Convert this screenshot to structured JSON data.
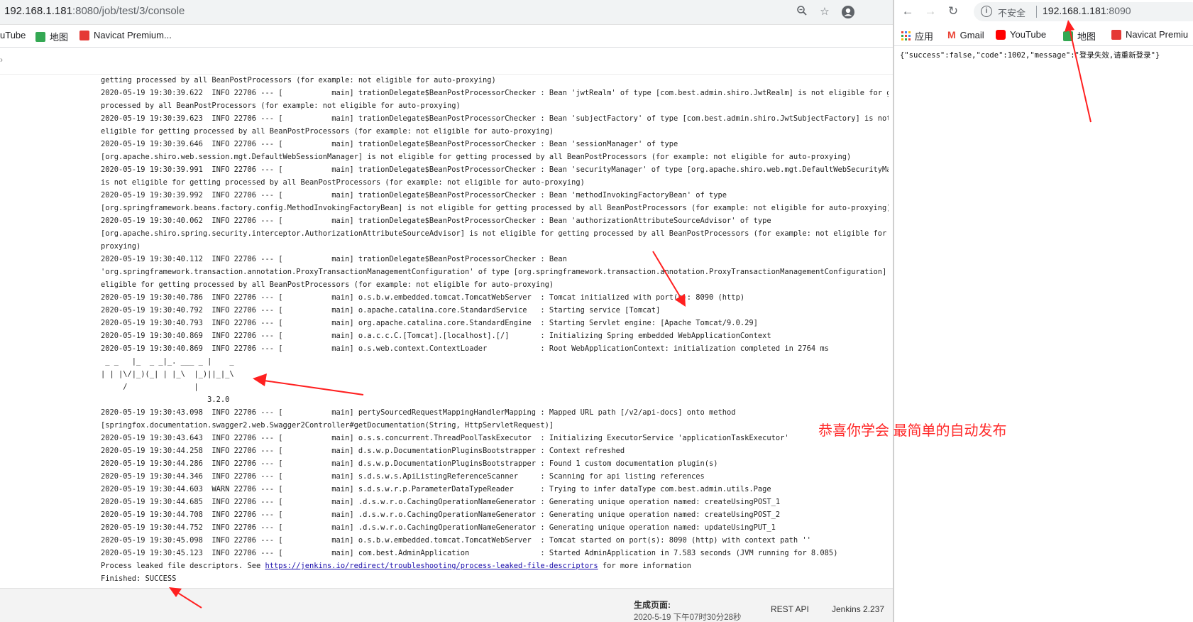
{
  "left_browser": {
    "url_host": "192.168.1.181",
    "url_path": ":8080/job/test/3/console",
    "bookmarks": [
      {
        "label": "uTube",
        "color": "#ff0000"
      },
      {
        "label": "地图",
        "color": "#34a853"
      },
      {
        "label": "Navicat Premium...",
        "color": "#e53935"
      }
    ]
  },
  "console_lines": [
    "getting processed by all BeanPostProcessors (for example: not eligible for auto-proxying)",
    "2020-05-19 19:30:39.622  INFO 22706 --- [           main] trationDelegate$BeanPostProcessorChecker : Bean 'jwtRealm' of type [com.best.admin.shiro.JwtRealm] is not eligible for getting",
    "processed by all BeanPostProcessors (for example: not eligible for auto-proxying)",
    "2020-05-19 19:30:39.623  INFO 22706 --- [           main] trationDelegate$BeanPostProcessorChecker : Bean 'subjectFactory' of type [com.best.admin.shiro.JwtSubjectFactory] is not",
    "eligible for getting processed by all BeanPostProcessors (for example: not eligible for auto-proxying)",
    "2020-05-19 19:30:39.646  INFO 22706 --- [           main] trationDelegate$BeanPostProcessorChecker : Bean 'sessionManager' of type",
    "[org.apache.shiro.web.session.mgt.DefaultWebSessionManager] is not eligible for getting processed by all BeanPostProcessors (for example: not eligible for auto-proxying)",
    "2020-05-19 19:30:39.991  INFO 22706 --- [           main] trationDelegate$BeanPostProcessorChecker : Bean 'securityManager' of type [org.apache.shiro.web.mgt.DefaultWebSecurityManager]",
    "is not eligible for getting processed by all BeanPostProcessors (for example: not eligible for auto-proxying)",
    "2020-05-19 19:30:39.992  INFO 22706 --- [           main] trationDelegate$BeanPostProcessorChecker : Bean 'methodInvokingFactoryBean' of type",
    "[org.springframework.beans.factory.config.MethodInvokingFactoryBean] is not eligible for getting processed by all BeanPostProcessors (for example: not eligible for auto-proxying)",
    "2020-05-19 19:30:40.062  INFO 22706 --- [           main] trationDelegate$BeanPostProcessorChecker : Bean 'authorizationAttributeSourceAdvisor' of type",
    "[org.apache.shiro.spring.security.interceptor.AuthorizationAttributeSourceAdvisor] is not eligible for getting processed by all BeanPostProcessors (for example: not eligible for auto-",
    "proxying)",
    "2020-05-19 19:30:40.112  INFO 22706 --- [           main] trationDelegate$BeanPostProcessorChecker : Bean",
    "'org.springframework.transaction.annotation.ProxyTransactionManagementConfiguration' of type [org.springframework.transaction.annotation.ProxyTransactionManagementConfiguration] is not",
    "eligible for getting processed by all BeanPostProcessors (for example: not eligible for auto-proxying)",
    "2020-05-19 19:30:40.786  INFO 22706 --- [           main] o.s.b.w.embedded.tomcat.TomcatWebServer  : Tomcat initialized with port(s): 8090 (http)",
    "2020-05-19 19:30:40.792  INFO 22706 --- [           main] o.apache.catalina.core.StandardService   : Starting service [Tomcat]",
    "2020-05-19 19:30:40.793  INFO 22706 --- [           main] org.apache.catalina.core.StandardEngine  : Starting Servlet engine: [Apache Tomcat/9.0.29]",
    "2020-05-19 19:30:40.869  INFO 22706 --- [           main] o.a.c.c.C.[Tomcat].[localhost].[/]       : Initializing Spring embedded WebApplicationContext",
    "2020-05-19 19:30:40.869  INFO 22706 --- [           main] o.s.web.context.ContextLoader            : Root WebApplicationContext: initialization completed in 2764 ms",
    " _ _   |_  _ _|_. ___ _ |    _",
    "| | |\\/|_)(_| | |_\\  |_)||_|_\\",
    "     /               |",
    "                        3.2.0",
    "2020-05-19 19:30:43.098  INFO 22706 --- [           main] pertySourcedRequestMappingHandlerMapping : Mapped URL path [/v2/api-docs] onto method",
    "[springfox.documentation.swagger2.web.Swagger2Controller#getDocumentation(String, HttpServletRequest)]",
    "2020-05-19 19:30:43.643  INFO 22706 --- [           main] o.s.s.concurrent.ThreadPoolTaskExecutor  : Initializing ExecutorService 'applicationTaskExecutor'",
    "2020-05-19 19:30:44.258  INFO 22706 --- [           main] d.s.w.p.DocumentationPluginsBootstrapper : Context refreshed",
    "2020-05-19 19:30:44.286  INFO 22706 --- [           main] d.s.w.p.DocumentationPluginsBootstrapper : Found 1 custom documentation plugin(s)",
    "2020-05-19 19:30:44.346  INFO 22706 --- [           main] s.d.s.w.s.ApiListingReferenceScanner     : Scanning for api listing references",
    "2020-05-19 19:30:44.603  WARN 22706 --- [           main] s.d.s.w.r.p.ParameterDataTypeReader      : Trying to infer dataType com.best.admin.utils.Page",
    "2020-05-19 19:30:44.685  INFO 22706 --- [           main] .d.s.w.r.o.CachingOperationNameGenerator : Generating unique operation named: createUsingPOST_1",
    "2020-05-19 19:30:44.708  INFO 22706 --- [           main] .d.s.w.r.o.CachingOperationNameGenerator : Generating unique operation named: createUsingPOST_2",
    "2020-05-19 19:30:44.752  INFO 22706 --- [           main] .d.s.w.r.o.CachingOperationNameGenerator : Generating unique operation named: updateUsingPUT_1",
    "2020-05-19 19:30:45.098  INFO 22706 --- [           main] o.s.b.w.embedded.tomcat.TomcatWebServer  : Tomcat started on port(s): 8090 (http) with context path ''",
    "2020-05-19 19:30:45.123  INFO 22706 --- [           main] com.best.AdminApplication                : Started AdminApplication in 7.583 seconds (JVM running for 8.085)"
  ],
  "leaked_line": {
    "prefix": "Process leaked file descriptors. See ",
    "link": "https://jenkins.io/redirect/troubleshooting/process-leaked-file-descriptors",
    "suffix": " for more information"
  },
  "finished_line": "Finished: SUCCESS",
  "footer": {
    "generated_label": "生成页面:",
    "generated_date": "2020-5-19 下午07时30分28秒",
    "rest_api": "REST API",
    "version": "Jenkins 2.237"
  },
  "right_browser": {
    "insecure_label": "不安全",
    "url_host": "192.168.1.181",
    "url_port": ":8090",
    "bookmarks": [
      {
        "label": "应用",
        "color": "#4285f4"
      },
      {
        "label": "Gmail",
        "color": "#ea4335"
      },
      {
        "label": "YouTube",
        "color": "#ff0000"
      },
      {
        "label": "地图",
        "color": "#34a853"
      },
      {
        "label": "Navicat Premiu",
        "color": "#e53935"
      }
    ],
    "json_body": "{\"success\":false,\"code\":1002,\"message\":\"登录失效,请重新登录\"}"
  },
  "caption": "恭喜你学会  最简单的自动发布",
  "annotation_color": "#ff2020"
}
